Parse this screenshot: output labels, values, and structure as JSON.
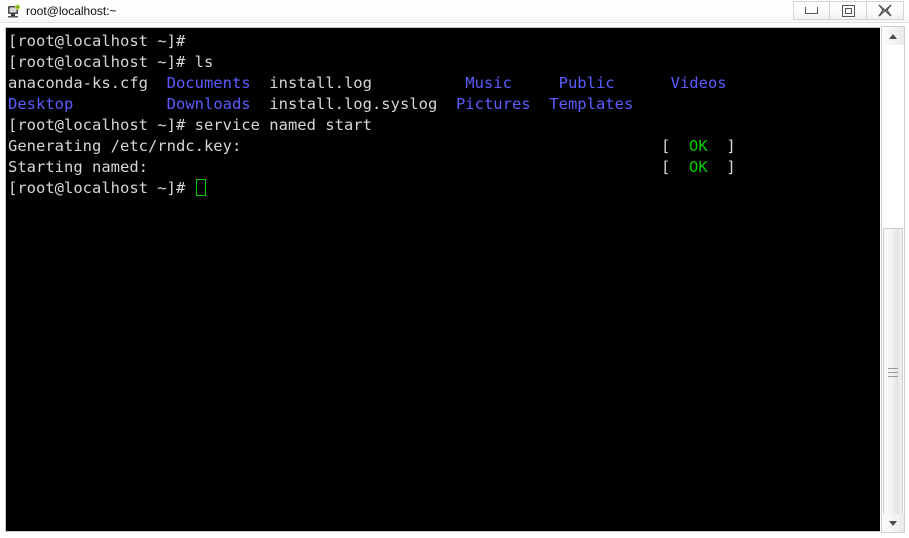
{
  "window": {
    "title": "root@localhost:~",
    "icon": "terminal-computer-icon",
    "controls": {
      "minimize": "–",
      "maximize": "□",
      "close": "✕"
    }
  },
  "terminal": {
    "background_color": "#000000",
    "foreground_color": "#d6d6d6",
    "directory_color": "#5c5cff",
    "ok_color": "#00cc00",
    "cursor_color": "#00d000",
    "lines": [
      {
        "id": "prompt-line-1",
        "segments": [
          {
            "text": "[root@localhost ~]# ",
            "color": "white"
          }
        ]
      },
      {
        "id": "command-ls-line",
        "segments": [
          {
            "text": "[root@localhost ~]# ",
            "color": "white"
          },
          {
            "text": "ls",
            "color": "white"
          }
        ]
      },
      {
        "id": "ls-output-row-1",
        "segments": [
          {
            "text": "anaconda-ks.cfg  ",
            "color": "white"
          },
          {
            "text": "Documents",
            "color": "blue"
          },
          {
            "text": "  install.log          ",
            "color": "white"
          },
          {
            "text": "Music",
            "color": "blue"
          },
          {
            "text": "     ",
            "color": "white"
          },
          {
            "text": "Public",
            "color": "blue"
          },
          {
            "text": "      ",
            "color": "white"
          },
          {
            "text": "Videos",
            "color": "blue"
          }
        ]
      },
      {
        "id": "ls-output-row-2",
        "segments": [
          {
            "text": "",
            "color": "white"
          },
          {
            "text": "Desktop",
            "color": "blue"
          },
          {
            "text": "          ",
            "color": "white"
          },
          {
            "text": "Downloads",
            "color": "blue"
          },
          {
            "text": "  install.log.syslog  ",
            "color": "white"
          },
          {
            "text": "Pictures",
            "color": "blue"
          },
          {
            "text": "  ",
            "color": "white"
          },
          {
            "text": "Templates",
            "color": "blue"
          }
        ]
      },
      {
        "id": "command-service-line",
        "segments": [
          {
            "text": "[root@localhost ~]# ",
            "color": "white"
          },
          {
            "text": "service named start",
            "color": "white"
          }
        ]
      },
      {
        "id": "generating-rndc-key-line",
        "segments": [
          {
            "text": "Generating /etc/rndc.key:",
            "color": "white"
          }
        ],
        "status": {
          "open": "[",
          "label": "OK",
          "close": "]"
        }
      },
      {
        "id": "starting-named-line",
        "segments": [
          {
            "text": "Starting named:",
            "color": "white"
          }
        ],
        "status": {
          "open": "[",
          "label": "OK",
          "close": "]"
        }
      },
      {
        "id": "prompt-line-final",
        "segments": [
          {
            "text": "[root@localhost ~]# ",
            "color": "white"
          }
        ],
        "cursor": true
      }
    ]
  },
  "scrollbar": {
    "up_arrow": "scroll-up",
    "down_arrow": "scroll-down",
    "thumb": "scroll-thumb"
  }
}
